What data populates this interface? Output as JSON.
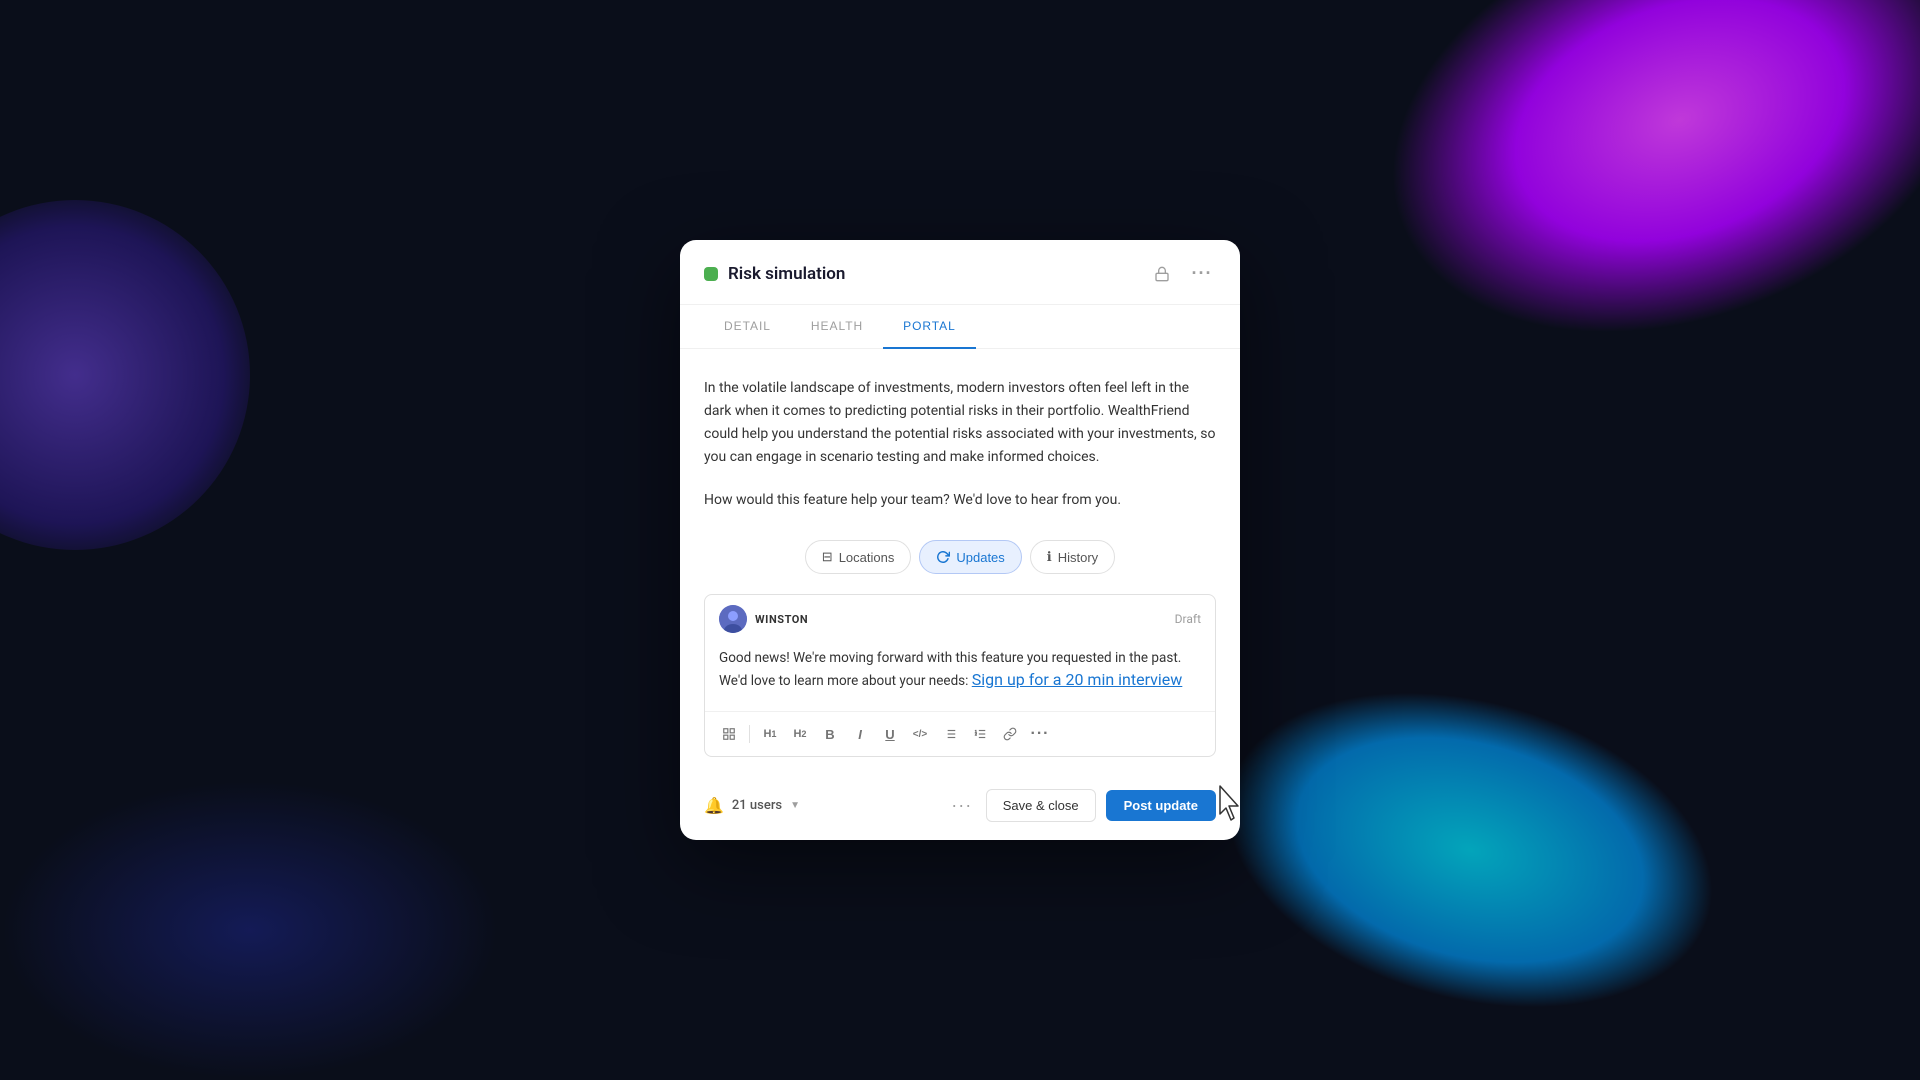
{
  "background": {
    "label": "background"
  },
  "modal": {
    "title": "Risk simulation",
    "status_color": "#4caf50",
    "tabs": [
      {
        "id": "detail",
        "label": "DETAIL",
        "active": false
      },
      {
        "id": "health",
        "label": "HEALTH",
        "active": false
      },
      {
        "id": "portal",
        "label": "PORTAL",
        "active": true
      }
    ],
    "portal": {
      "description": "In the volatile landscape of investments, modern investors often feel left in the dark when it comes to predicting potential risks in their portfolio. WealthFriend could help you understand the potential risks associated with your investments, so you can engage in scenario testing and make informed choices.",
      "question": "How would this feature help your team? We'd love to hear from you.",
      "sub_tabs": [
        {
          "id": "locations",
          "label": "Locations",
          "icon": "⊟",
          "active": false
        },
        {
          "id": "updates",
          "label": "Updates",
          "icon": "↻",
          "active": true
        },
        {
          "id": "history",
          "label": "History",
          "icon": "ℹ",
          "active": false
        }
      ],
      "composer": {
        "username": "WINSTON",
        "draft_label": "Draft",
        "message_text": "Good news! We're moving forward with this feature you requested in the past. We'd love to learn more about your needs: ",
        "link_text": "Sign up for a 20 min interview",
        "toolbar_buttons": [
          {
            "id": "template",
            "label": "⊟"
          },
          {
            "id": "h1",
            "label": "H1"
          },
          {
            "id": "h2",
            "label": "H2"
          },
          {
            "id": "bold",
            "label": "B"
          },
          {
            "id": "italic",
            "label": "I"
          },
          {
            "id": "underline",
            "label": "U"
          },
          {
            "id": "code",
            "label": "</>"
          },
          {
            "id": "bullet-list",
            "label": "≡"
          },
          {
            "id": "ordered-list",
            "label": "≡"
          },
          {
            "id": "link",
            "label": "🔗"
          },
          {
            "id": "more",
            "label": "···"
          }
        ]
      },
      "footer": {
        "users_count": "21 users",
        "save_close_label": "Save & close",
        "post_update_label": "Post update"
      }
    }
  }
}
